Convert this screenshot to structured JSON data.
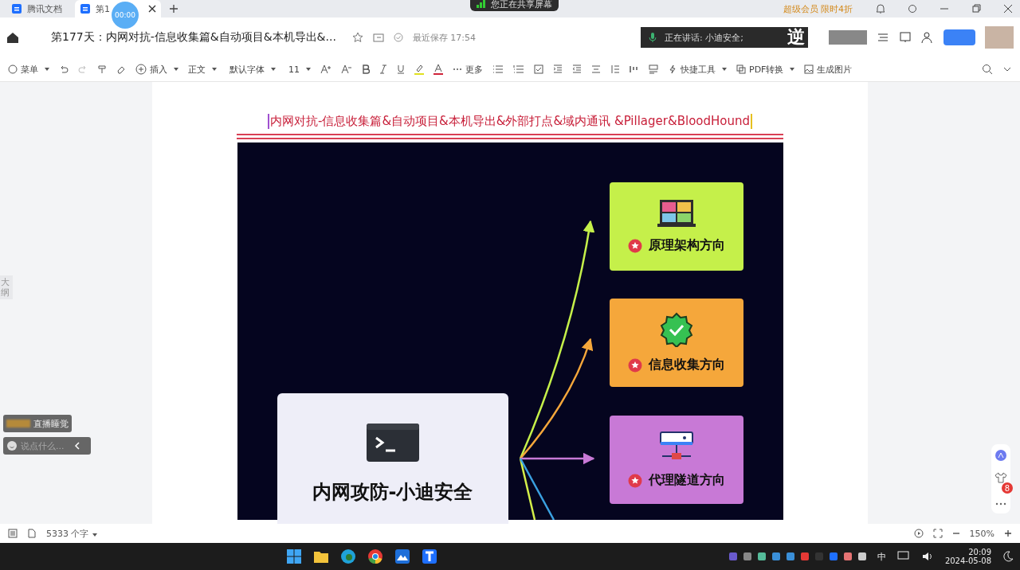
{
  "browser_tabs": [
    {
      "label": "腾讯文档",
      "selected": false
    },
    {
      "label": "第1",
      "selected": true
    }
  ],
  "recording_timer": "00:00",
  "share_banner": "您正在共享屏幕",
  "promo": "超级会员 限时4折",
  "document": {
    "title": "第177天：内网对抗-信息收集篇&自动项目&本机导出&...",
    "save_status": "最近保存 17:54"
  },
  "speaker": {
    "label": "正在讲话:  小迪安全;",
    "overlay_char": "逆"
  },
  "toolbar": {
    "menu": "菜单",
    "insert": "插入",
    "style": "正文",
    "font": "默认字体",
    "size": "11",
    "more": "更多",
    "quick_tools": "快捷工具",
    "pdf": "PDF转换",
    "image": "生成图片"
  },
  "heading": "内网对抗-信息收集篇&自动项目&本机导出&外部打点&域内通讯 &Pillager&BloodHound",
  "diagram": {
    "center": "内网攻防-小迪安全",
    "cards": [
      {
        "kind": "monitor",
        "label": "原理架构方向",
        "color": "#c5f04a"
      },
      {
        "kind": "badge",
        "label": "信息收集方向",
        "color": "#f5a73b"
      },
      {
        "kind": "server",
        "label": "代理隧道方向",
        "color": "#c879d6"
      }
    ]
  },
  "outline_tab": "大纲",
  "chat": {
    "message": "直播睡觉",
    "placeholder": "说点什么..."
  },
  "notification_count": "8",
  "status_bar": {
    "word_count": "5333 个字",
    "zoom": "150%"
  },
  "taskbar": {
    "ime": "中",
    "time": "20:09",
    "date": "2024-05-08"
  }
}
